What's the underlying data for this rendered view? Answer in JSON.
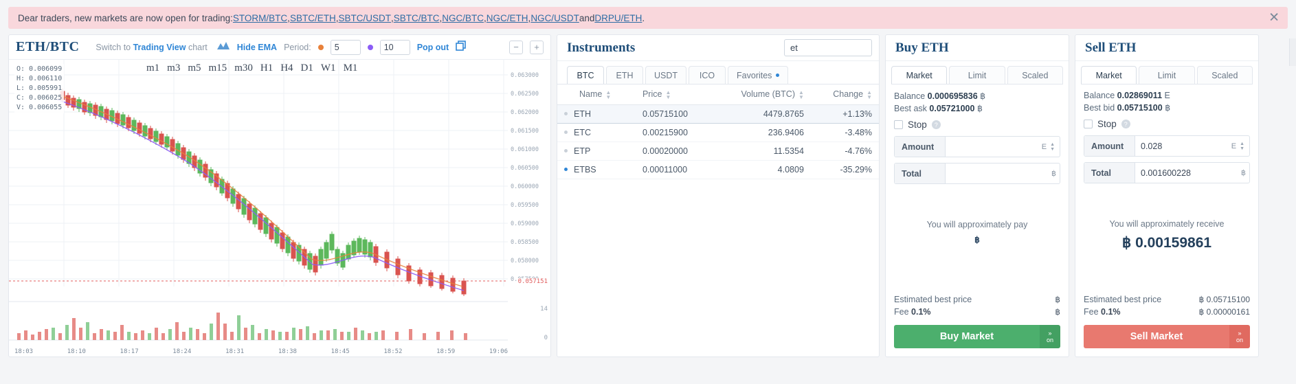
{
  "banner": {
    "text_before": "Dear traders, new markets are now open for trading: ",
    "links": [
      "STORM/BTC",
      "SBTC/ETH",
      "SBTC/USDT",
      "SBTC/BTC",
      "NGC/BTC",
      "NGC/ETH",
      "NGC/USDT",
      "DRPU/ETH"
    ],
    "conjunction": " and ",
    "period": ".",
    "close_icon": "✕"
  },
  "chart": {
    "pair": "ETH/BTC",
    "switch_prefix": "Switch to ",
    "switch_link": "Trading View",
    "switch_suffix": " chart",
    "hide_ema": "Hide EMA",
    "period_label": "Period:",
    "ema_fast": "5",
    "ema_slow": "10",
    "popout": "Pop out",
    "zoom_out": "−",
    "zoom_in": "+",
    "timeframes": [
      "m1",
      "m3",
      "m5",
      "m15",
      "m30",
      "H1",
      "H4",
      "D1",
      "W1",
      "M1"
    ],
    "ohlc": {
      "open": "O: 0.006099",
      "high": "H: 0.006110",
      "low": "L: 0.005991",
      "close": "C: 0.006025",
      "volume": "V: 0.006055"
    },
    "y_ticks": [
      "0.063000",
      "0.062500",
      "0.062000",
      "0.061500",
      "0.061000",
      "0.060500",
      "0.060000",
      "0.059500",
      "0.059000",
      "0.058500",
      "0.058000",
      "0.057500"
    ],
    "last_price": "0.057151",
    "x_ticks": [
      "18:03",
      "18:10",
      "18:17",
      "18:24",
      "18:31",
      "18:38",
      "18:45",
      "18:52",
      "18:59",
      "19:06"
    ],
    "volume_ticks": [
      "14",
      "0"
    ]
  },
  "instruments": {
    "title": "Instruments",
    "search_value": "et",
    "search_placeholder": "",
    "tabs": [
      {
        "label": "BTC",
        "active": true,
        "dot": false
      },
      {
        "label": "ETH",
        "active": false,
        "dot": false
      },
      {
        "label": "USDT",
        "active": false,
        "dot": false
      },
      {
        "label": "ICO",
        "active": false,
        "dot": false
      },
      {
        "label": "Favorites",
        "active": false,
        "dot": true
      }
    ],
    "columns": [
      "Name",
      "Price",
      "Volume (BTC)",
      "Change"
    ],
    "rows": [
      {
        "name": "ETH",
        "price": "0.05715100",
        "volume": "4479.8765",
        "change": "+1.13%",
        "dir": "up",
        "selected": true,
        "fav": false
      },
      {
        "name": "ETC",
        "price": "0.00215900",
        "volume": "236.9406",
        "change": "-3.48%",
        "dir": "down",
        "selected": false,
        "fav": false
      },
      {
        "name": "ETP",
        "price": "0.00020000",
        "volume": "11.5354",
        "change": "-4.76%",
        "dir": "down",
        "selected": false,
        "fav": false
      },
      {
        "name": "ETBS",
        "price": "0.00011000",
        "volume": "4.0809",
        "change": "-35.29%",
        "dir": "down",
        "selected": false,
        "fav": true
      }
    ]
  },
  "buy": {
    "title": "Buy ETH",
    "tabs": [
      "Market",
      "Limit",
      "Scaled"
    ],
    "active_tab": "Market",
    "balance_label": "Balance",
    "balance_value": "0.000695836",
    "balance_currency": "฿",
    "best_label": "Best ask",
    "best_value": "0.05721000",
    "best_currency": "฿",
    "stop_label": "Stop",
    "amount_label": "Amount",
    "amount_value": "",
    "amount_currency": "E",
    "total_label": "Total",
    "total_value": "",
    "total_currency": "฿",
    "approx_label": "You will approximately pay",
    "approx_value": "฿",
    "est_price_label": "Estimated best price",
    "est_price_value": "฿",
    "fee_label": "Fee",
    "fee_pct": "0.1%",
    "fee_value": "฿",
    "action_label": "Buy Market",
    "action_side_icon": "»",
    "action_side_text": "on"
  },
  "sell": {
    "title": "Sell ETH",
    "tabs": [
      "Market",
      "Limit",
      "Scaled"
    ],
    "active_tab": "Market",
    "balance_label": "Balance",
    "balance_value": "0.02869011",
    "balance_currency": "E",
    "best_label": "Best bid",
    "best_value": "0.05715100",
    "best_currency": "฿",
    "stop_label": "Stop",
    "amount_label": "Amount",
    "amount_value": "0.028",
    "amount_currency": "E",
    "total_label": "Total",
    "total_value": "0.001600228",
    "total_currency": "฿",
    "approx_label": "You will approximately receive",
    "approx_value": "฿ 0.00159861",
    "est_price_label": "Estimated best price",
    "est_price_value": "฿ 0.05715100",
    "fee_label": "Fee",
    "fee_pct": "0.1%",
    "fee_value": "฿ 0.00000161",
    "action_label": "Sell Market",
    "action_side_icon": "»",
    "action_side_text": "on"
  },
  "colors": {
    "up": "#3aa34a",
    "down": "#e05c5c",
    "brand": "#1f4e79",
    "link": "#2f86d6",
    "buy": "#4caf6d",
    "sell": "#e8796f",
    "banner_bg": "#f9d7dc"
  }
}
